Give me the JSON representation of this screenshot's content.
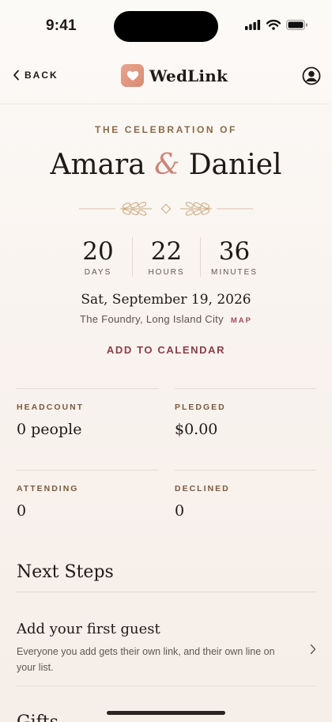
{
  "status": {
    "time": "9:41"
  },
  "nav": {
    "back_label": "BACK",
    "brand": "WedLink"
  },
  "hero": {
    "kicker": "THE CELEBRATION OF",
    "name_a": "Amara",
    "ampersand": "&",
    "name_b": "Daniel"
  },
  "countdown": [
    {
      "value": "20",
      "label": "DAYS"
    },
    {
      "value": "22",
      "label": "HOURS"
    },
    {
      "value": "36",
      "label": "MINUTES"
    }
  ],
  "event": {
    "date": "Sat, September 19, 2026",
    "venue": "The Foundry, Long Island City",
    "map_label": "MAP",
    "calendar_label": "ADD TO CALENDAR"
  },
  "stats": [
    {
      "label": "HEADCOUNT",
      "value": "0 people"
    },
    {
      "label": "PLEDGED",
      "value": "$0.00"
    },
    {
      "label": "ATTENDING",
      "value": "0"
    },
    {
      "label": "DECLINED",
      "value": "0"
    }
  ],
  "next_steps": {
    "title": "Next Steps",
    "items": [
      {
        "title": "Add your first guest",
        "description": "Everyone you add gets their own link, and their own line on your list."
      }
    ]
  },
  "gifts": {
    "title": "Gifts"
  },
  "colors": {
    "accent": "#8a3e49",
    "gold": "#8a6a45",
    "logo": "#e09a84"
  },
  "icons": [
    "back-chevron-icon",
    "heart-icon",
    "profile-icon",
    "signal-icon",
    "wifi-icon",
    "battery-icon",
    "chevron-right-icon"
  ]
}
